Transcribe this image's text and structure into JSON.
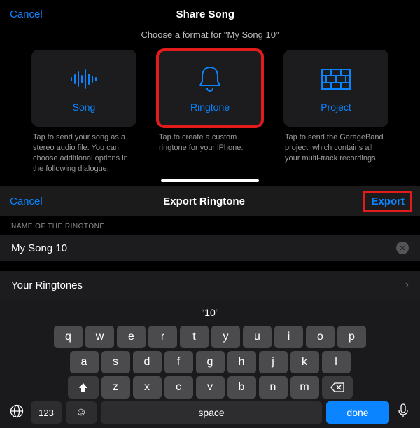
{
  "top": {
    "cancel": "Cancel",
    "title": "Share Song",
    "subtitle": "Choose a format for \"My Song 10\"",
    "cards": [
      {
        "label": "Song",
        "desc": "Tap to send your song as a stereo audio file. You can choose additional options in the following dialogue."
      },
      {
        "label": "Ringtone",
        "desc": "Tap to create a custom ringtone for your iPhone."
      },
      {
        "label": "Project",
        "desc": "Tap to send the GarageBand project, which contains all your multi-track recordings."
      }
    ]
  },
  "bottom": {
    "cancel": "Cancel",
    "title": "Export Ringtone",
    "export": "Export",
    "sectionLabel": "NAME OF THE RINGTONE",
    "ringtoneName": "My Song 10",
    "yourRingtones": "Your Ringtones"
  },
  "keyboard": {
    "suggestion": "10",
    "rows": {
      "r1": [
        "q",
        "w",
        "e",
        "r",
        "t",
        "y",
        "u",
        "i",
        "o",
        "p"
      ],
      "r2": [
        "a",
        "s",
        "d",
        "f",
        "g",
        "h",
        "j",
        "k",
        "l"
      ],
      "r3": [
        "z",
        "x",
        "c",
        "v",
        "b",
        "n",
        "m"
      ]
    },
    "k123": "123",
    "space": "space",
    "done": "done"
  }
}
